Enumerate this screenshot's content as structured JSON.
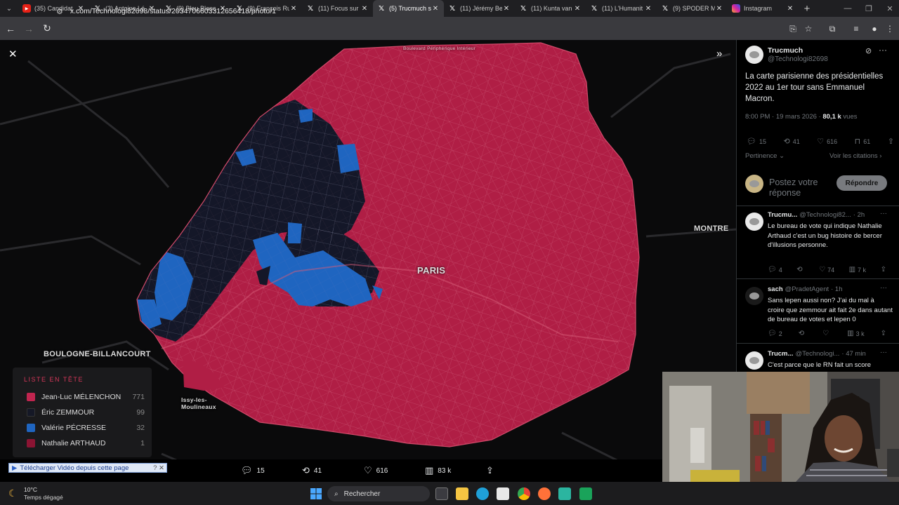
{
  "tabs": [
    {
      "icon": "youtube-icon",
      "label": "(35) Candidat"
    },
    {
      "icon": "x-icon",
      "label": "(3) Antoine Lé"
    },
    {
      "icon": "x-icon",
      "label": "(9) Bleu Blanc"
    },
    {
      "icon": "x-icon",
      "label": "(9) François Ru"
    },
    {
      "icon": "x-icon",
      "label": "(11) Focus sur"
    },
    {
      "icon": "x-icon",
      "label": "(5) Trucmuch s"
    },
    {
      "icon": "x-icon",
      "label": "(11) Jérémy Be"
    },
    {
      "icon": "x-icon",
      "label": "(11) Kunta van"
    },
    {
      "icon": "x-icon",
      "label": "(11) L'Humanit"
    },
    {
      "icon": "x-icon",
      "label": "(9) SPODER M"
    },
    {
      "icon": "instagram-icon",
      "label": "Instagram"
    }
  ],
  "active_tab_index": 5,
  "address": {
    "url": "x.com/Technologi82698/status/2034706603312656418/photo/1"
  },
  "map": {
    "labels": {
      "paris": "PARIS",
      "boulogne": "BOULOGNE-BILLANCOURT",
      "issy": "Issy-les-Moulineaux",
      "montreuil": "MONTRE",
      "perif_top": "Boulevard Périphérique Intérieur"
    },
    "colors": {
      "melenchon": "#b01e45",
      "zemmour": "#141728",
      "pecresse": "#1f65c0",
      "arthaud": "#8b1433",
      "background": "#0a0a0b",
      "roads": "#3a3a3e"
    }
  },
  "legend": {
    "title": "LISTE EN TÊTE",
    "items": [
      {
        "name": "Jean-Luc MÉLENCHON",
        "count": "771",
        "color": "#c0254f"
      },
      {
        "name": "Éric ZEMMOUR",
        "count": "99",
        "color": "#151826"
      },
      {
        "name": "Valérie PÉCRESSE",
        "count": "32",
        "color": "#1f65c0"
      },
      {
        "name": "Nathalie ARTHAUD",
        "count": "1",
        "color": "#8b1433"
      }
    ]
  },
  "viewer_actions": {
    "replies": "15",
    "reposts": "41",
    "likes": "616",
    "views": "83 k"
  },
  "download_bar": {
    "label": "Télécharger Vidéo depuis cette page"
  },
  "tweet": {
    "author": "Trucmuch",
    "handle": "@Technologi82698",
    "text": "La carte parisienne des présidentielles 2022 au 1er tour sans Emmanuel Macron.",
    "time": "8:00 PM · 19 mars 2026 ·",
    "views_count": "80,1 k",
    "views_label": "vues",
    "replies": "15",
    "reposts": "41",
    "likes": "616",
    "bookmarks": "61",
    "sort": "Pertinence",
    "quotes_link": "Voir les citations",
    "reply_placeholder": "Postez votre réponse",
    "reply_button": "Répondre"
  },
  "replies": [
    {
      "author": "Trucmu...",
      "handle": "@Technologi82...",
      "time": "· 2h",
      "text": "Le bureau de vote qui indique Nathalie Arthaud c'est un bug histoire de bercer d'illusions personne.",
      "replies": "4",
      "reposts": "",
      "likes": "74",
      "views": "7 k"
    },
    {
      "author": "sach",
      "handle": "@PradetAgent",
      "time": "· 1h",
      "text": "Sans lepen aussi non? J'ai du mal à croire  que zemmour ait fait 2e dans autant de bureau de votes et lepen 0",
      "replies": "2",
      "reposts": "",
      "likes": "",
      "views": "3 k"
    },
    {
      "author": "Trucm...",
      "handle": "@Technologi...",
      "time": "· 47 min",
      "text": "C'est parce que le RN fait un score"
    }
  ],
  "taskbar": {
    "weather_temp": "10°C",
    "weather_desc": "Temps dégagé",
    "search_placeholder": "Rechercher"
  }
}
